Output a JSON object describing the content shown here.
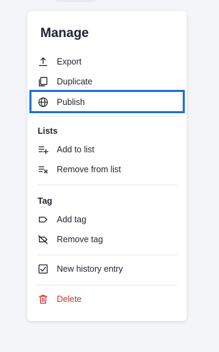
{
  "menu": {
    "title": "Manage",
    "items": [
      {
        "label": "Export",
        "icon": "export-icon"
      },
      {
        "label": "Duplicate",
        "icon": "duplicate-icon"
      },
      {
        "label": "Publish",
        "icon": "globe-icon",
        "selected": true
      }
    ],
    "lists": {
      "label": "Lists",
      "items": [
        {
          "label": "Add to list",
          "icon": "add-to-list-icon"
        },
        {
          "label": "Remove from list",
          "icon": "remove-from-list-icon"
        }
      ]
    },
    "tag": {
      "label": "Tag",
      "items": [
        {
          "label": "Add tag",
          "icon": "tag-icon"
        },
        {
          "label": "Remove tag",
          "icon": "tag-off-icon"
        }
      ]
    },
    "history": {
      "label": "New history entry",
      "icon": "checked-calendar-icon"
    },
    "delete": {
      "label": "Delete",
      "icon": "trash-icon"
    }
  },
  "colors": {
    "background": "#f4f5f8",
    "panel": "#ffffff",
    "text": "#1f2430",
    "selection_outline": "#1f6fd8",
    "danger": "#cf2f33",
    "divider": "#e6e7eb"
  }
}
